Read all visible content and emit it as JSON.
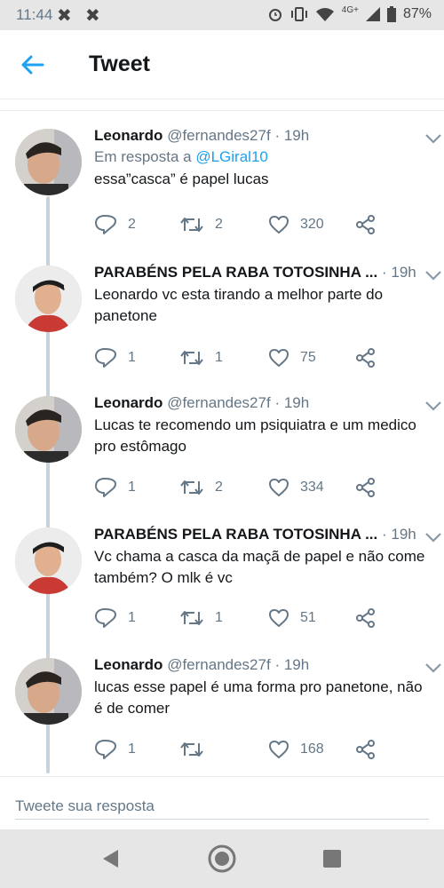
{
  "status_bar": {
    "time": "11:44",
    "network": "4G+",
    "battery": "87%",
    "icons": [
      "notification-icon",
      "notification-icon",
      "alarm-icon",
      "vibrate-icon",
      "wifi-icon",
      "signal-icon",
      "battery-icon"
    ]
  },
  "header": {
    "title": "Tweet",
    "back_icon": "arrow-left-icon"
  },
  "accent_color": "#1da1f2",
  "tweets": [
    {
      "name": "Leonardo",
      "handle": "@fernandes27f",
      "time": "· 19h",
      "reply_prefix": "Em resposta a",
      "reply_to": "@LGiral10",
      "text": "essa”casca” é papel lucas",
      "replies": "2",
      "retweets": "2",
      "likes": "320"
    },
    {
      "name": "PARABÉNS PELA RABA TOTOSINHA ...",
      "handle": "",
      "time": "· 19h",
      "text": "Leonardo vc esta tirando a melhor parte do panetone",
      "replies": "1",
      "retweets": "1",
      "likes": "75"
    },
    {
      "name": "Leonardo",
      "handle": "@fernandes27f",
      "time": "· 19h",
      "text": "Lucas te recomendo um psiquiatra e um medico pro estômago",
      "replies": "1",
      "retweets": "2",
      "likes": "334"
    },
    {
      "name": "PARABÉNS PELA RABA TOTOSINHA ...",
      "handle": "",
      "time": "· 19h",
      "text": "Vc chama a casca da maçã de papel e não come também? O mlk é vc",
      "replies": "1",
      "retweets": "1",
      "likes": "51"
    },
    {
      "name": "Leonardo",
      "handle": "@fernandes27f",
      "time": "· 19h",
      "text": "lucas esse papel é uma forma pro panetone, não é de comer",
      "replies": "1",
      "retweets": "",
      "likes": "168"
    }
  ],
  "reply_box": {
    "placeholder": "Tweete sua resposta"
  },
  "nav": {
    "icons": [
      "back-triangle-icon",
      "home-circle-icon",
      "recents-square-icon"
    ]
  }
}
